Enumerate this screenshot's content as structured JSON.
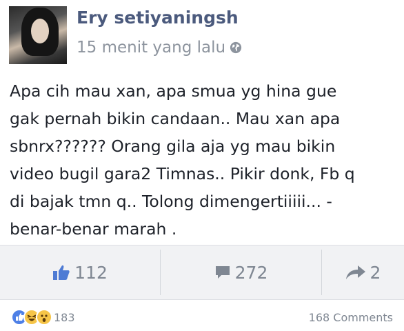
{
  "post": {
    "author": "Ery setiyaningsh",
    "time": "15 menit yang lalu",
    "text_lines": [
      "Apa cih mau xan, apa smua yg hina gue",
      "gak pernah bikin candaan.. Mau xan apa",
      "sbnrx?????? Orang gila aja yg mau bikin",
      "video bugil gara2 Timnas.. Pikir donk, Fb q",
      "di bajak tmn q.. Tolong dimengertiiiii... -",
      "benar-benar marah ."
    ]
  },
  "actions": {
    "likes": "112",
    "comments": "272",
    "shares": "2"
  },
  "footer": {
    "reaction_count": "183",
    "comments_label": "168 Comments"
  },
  "icons": {
    "privacy": "globe-icon",
    "like": "thumbs-up-icon",
    "comment": "speech-bubble-icon",
    "share": "share-arrow-icon"
  },
  "colors": {
    "name": "#4b5a7d",
    "like_blue": "#4e7bd4",
    "action_gray": "#7f8792"
  }
}
